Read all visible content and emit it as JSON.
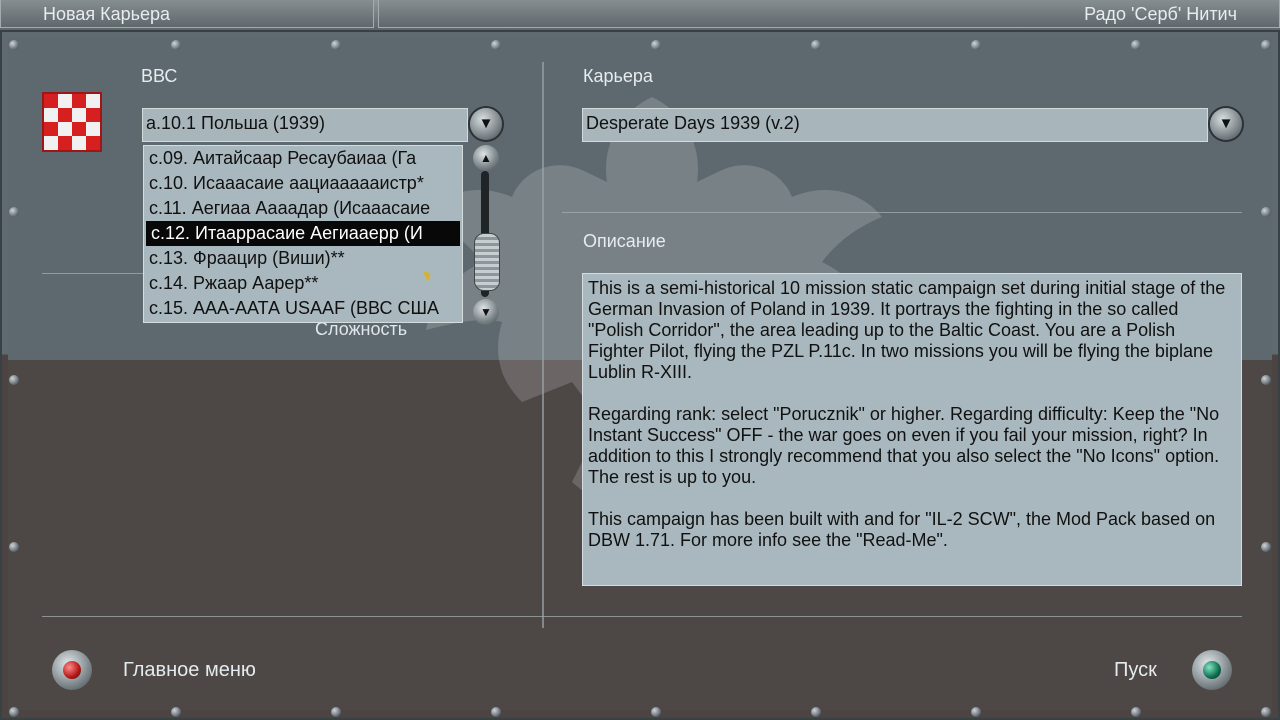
{
  "window": {
    "left_title": "Новая Карьера",
    "right_title": "Радо 'Серб' Нитич"
  },
  "left_section": {
    "label": "ВВС",
    "selected": "а.10.1 Польша (1939)",
    "options": [
      "с.09. Аитайсаар Ресаубаиаа (Га",
      "с.10. Исааасаие аациаааааистр*",
      "с.11. Аегиаа Аааадар (Исааасаие",
      "с.12. Итаарраcаие Аегиааерр (И",
      "с.13. Фраацир (Виши)**",
      "с.14. Ржаар Аарер**",
      "с.15. ААА-ААТА USAAF (ВВС США"
    ],
    "selected_index": 3,
    "hidden_label": "Сложность"
  },
  "right_section": {
    "career_label": "Карьера",
    "career_value": "Desperate Days 1939 (v.2)",
    "description_label": "Описание",
    "description_paragraphs": [
      "This is a semi-historical 10 mission static campaign set during initial stage of the German Invasion of Poland in 1939. It portrays the fighting in the so called \"Polish Corridor\", the area leading up to the Baltic Coast. You are a Polish Fighter Pilot, flying the PZL P.11c. In two missions you will be flying the biplane Lublin R-XIII.",
      "Regarding rank: select \"Porucznik\" or higher. Regarding difficulty: Keep the \"No Instant Success\" OFF - the war goes on even if you fail your mission, right? In addition to this I strongly recommend that you also select the \"No Icons\" option. The rest is up to you.",
      "This campaign has been built with and for \"IL-2 SCW\", the Mod Pack based on DBW 1.71. For more info see the \"Read-Me\"."
    ]
  },
  "bottom": {
    "main_menu_label": "Главное меню",
    "start_label": "Пуск"
  },
  "icons": {
    "dropdown_icon": "chevron-down-icon",
    "scroll_up_icon": "chevron-up-icon",
    "scroll_down_icon": "chevron-down-icon",
    "flag_icon": "polish-checkerboard-icon",
    "eagle_icon": "eagle-emblem-icon",
    "main_menu_icon": "red-lamp-icon",
    "start_icon": "green-lamp-icon"
  },
  "colors": {
    "panel": "#5f6b70",
    "lower_panel": "#4b4442",
    "field": "#a8b6bb",
    "accent_red": "#d61f1f",
    "lamp_red": "#b31616",
    "lamp_green": "#0d6c4e"
  }
}
